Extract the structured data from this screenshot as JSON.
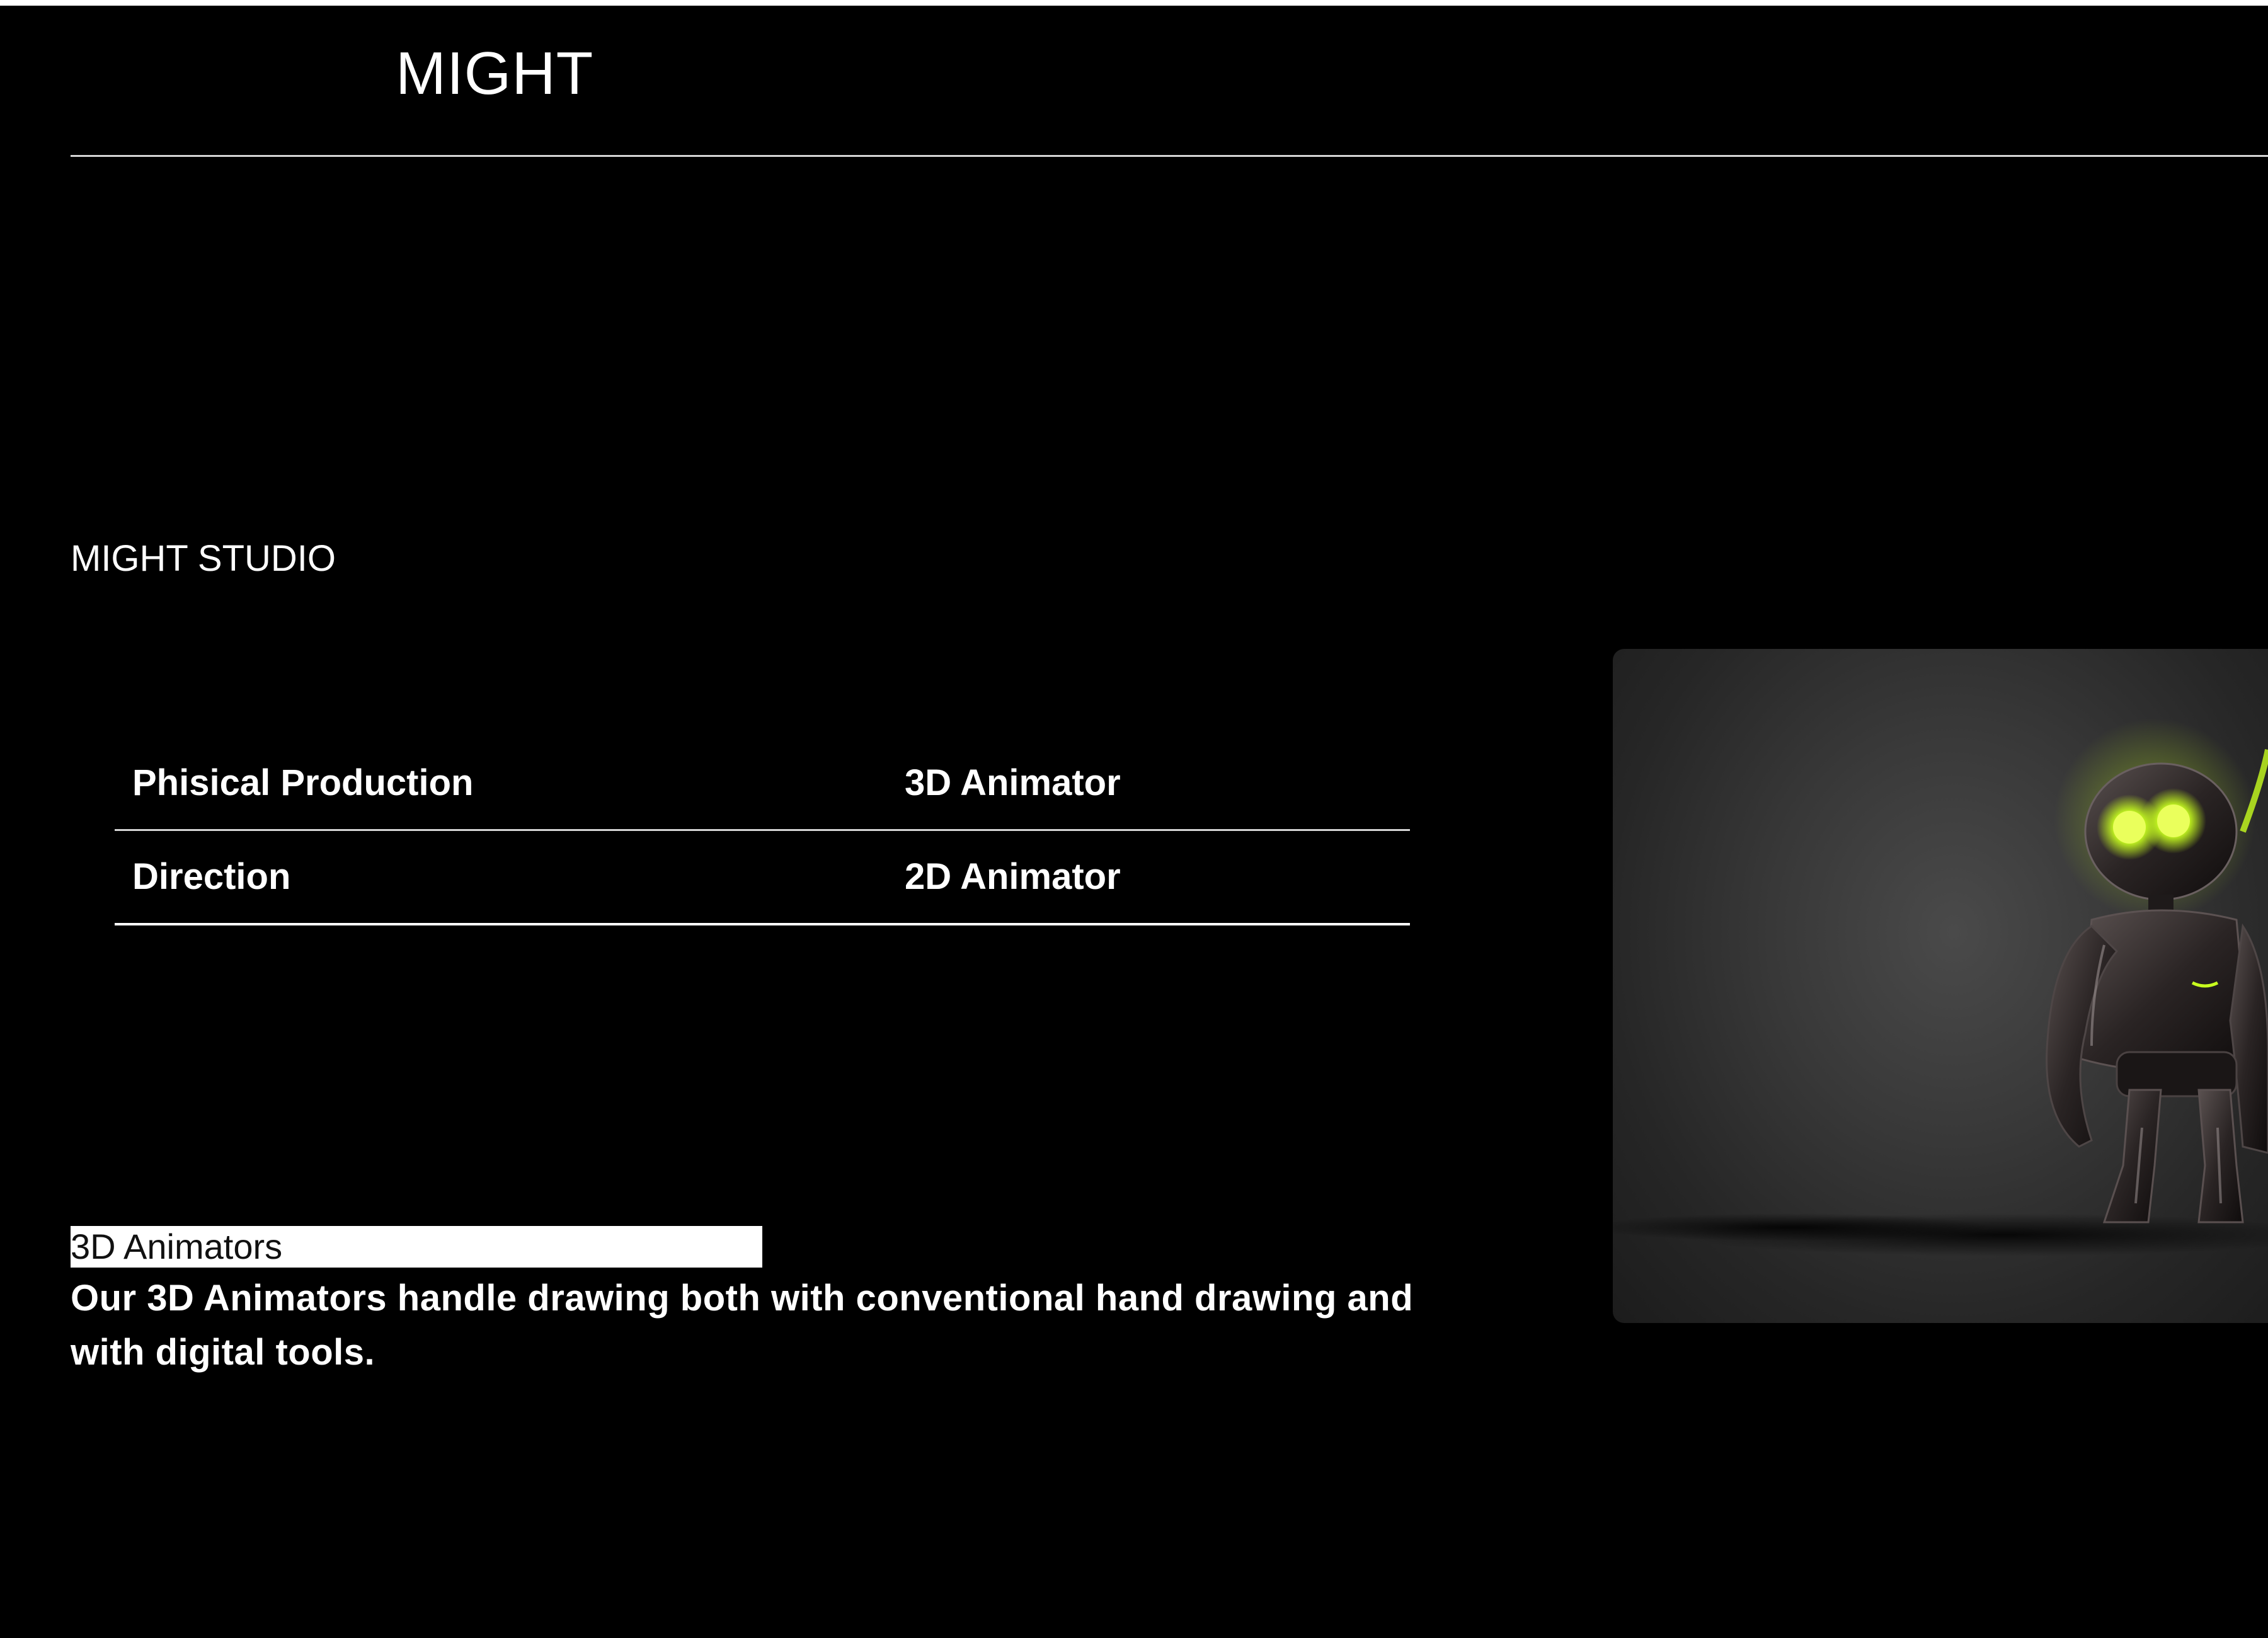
{
  "header": {
    "brand": "MIGHT"
  },
  "studio": {
    "name": "MIGHT STUDIO"
  },
  "roles": [
    {
      "left": "Phisical Production",
      "right": "3D Animator"
    },
    {
      "left": "Direction",
      "right": "2D Animator"
    }
  ],
  "section": {
    "title": "3D Animators",
    "text": "Our 3D Animators handle drawing both with conventional hand drawing and with digital tools."
  },
  "render": {
    "image_name": "robot-character-render",
    "glow_color": "#c8ff1e",
    "background_color": "#333333"
  }
}
